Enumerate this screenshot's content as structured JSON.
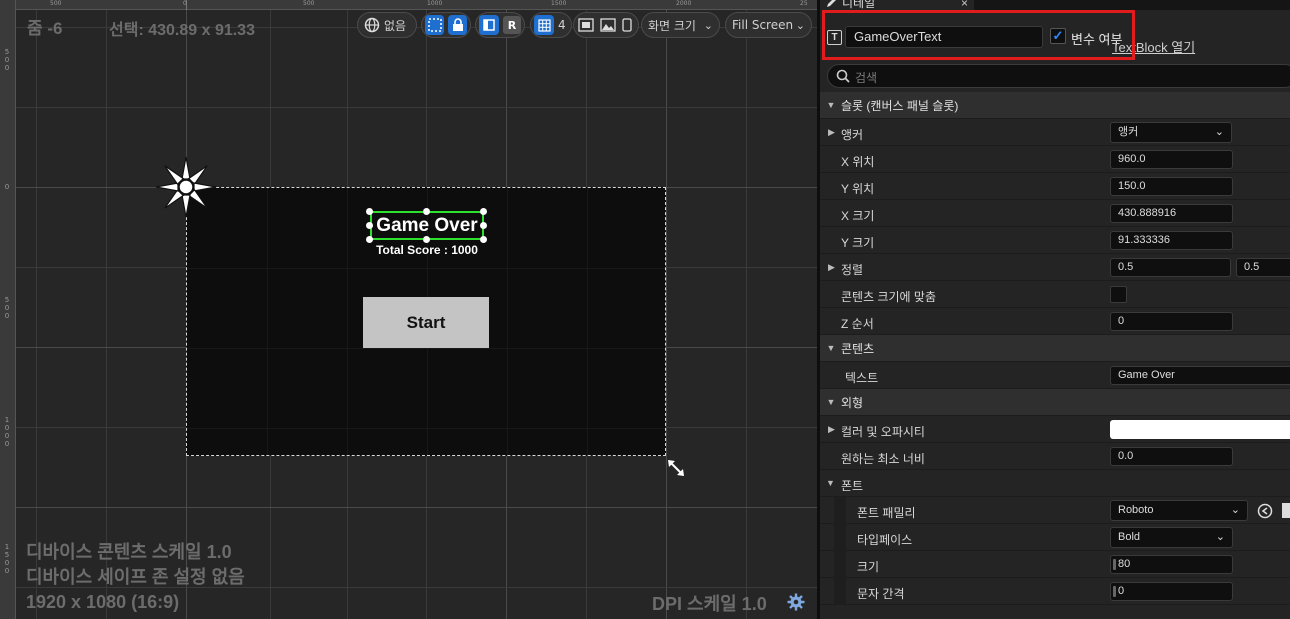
{
  "viewport": {
    "zoom": "줌 -6",
    "selection": "선택: 430.89 x 91.33",
    "ruler_top": [
      "500",
      "0",
      "500",
      "1000",
      "1500",
      "2000",
      "25"
    ],
    "ruler_left": [
      "5\n0\n0",
      "0",
      "5\n0\n0",
      "1\n0\n0\n0",
      "1\n5\n0\n0"
    ],
    "toolbar": {
      "localization_label": "없음",
      "respect_locks_label": "R",
      "grid_snap_value": "4",
      "screen_size_label": "화면 크기",
      "fill_screen_label": "Fill Screen"
    },
    "canvas": {
      "title_text": "Game Over",
      "score_text": "Total Score : 1000",
      "start_label": "Start"
    },
    "bottom_info": [
      "디바이스 콘텐츠 스케일 1.0",
      "디바이스 세이프 존 설정 없음",
      "1920 x 1080 (16:9)"
    ],
    "dpi": "DPI 스케일 1.0"
  },
  "details": {
    "tab_title": "디테일",
    "tab_close": "×",
    "widget_name": "GameOverText",
    "is_variable_checked": true,
    "is_variable_label": "변수 여부",
    "open_link": "TextBlock 열기",
    "search_placeholder": "검색",
    "categories": {
      "slot": "슬롯 (캔버스 패널 슬롯)",
      "content": "콘텐츠",
      "appearance": "외형",
      "font": "폰트"
    },
    "slot": {
      "anchor_label": "앵커",
      "anchor_value": "앵커",
      "pos_x_label": "X 위치",
      "pos_x": "960.0",
      "pos_y_label": "Y 위치",
      "pos_y": "150.0",
      "size_x_label": "X 크기",
      "size_x": "430.888916",
      "size_y_label": "Y 크기",
      "size_y": "91.333336",
      "alignment_label": "정렬",
      "alignment_x": "0.5",
      "alignment_y": "0.5",
      "autosize_label": "콘텐츠 크기에 맞춤",
      "zorder_label": "Z 순서",
      "zorder": "0"
    },
    "content": {
      "text_label": "텍스트",
      "text_value": "Game Over"
    },
    "appearance": {
      "color_label": "컬러 및 오파시티",
      "color_value": "#ffffff",
      "min_width_label": "원하는 최소 너비",
      "min_width": "0.0"
    },
    "font": {
      "family_label": "폰트 패밀리",
      "family": "Roboto",
      "typeface_label": "타입페이스",
      "typeface": "Bold",
      "size_label": "크기",
      "size": "80",
      "spacing_label": "문자 간격",
      "spacing": "0"
    }
  }
}
